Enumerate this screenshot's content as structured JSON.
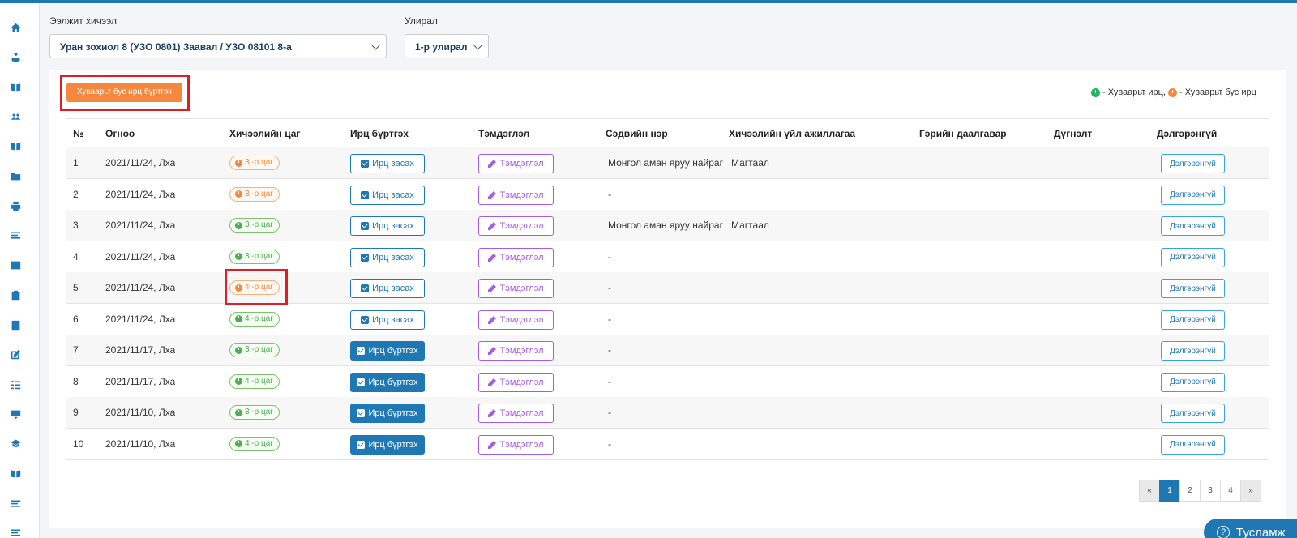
{
  "filters": {
    "course_label": "Ээлжит хичээл",
    "course_value": "Уран зохиол 8 (УЗО 0801) Заавал / УЗО 08101 8-а",
    "term_label": "Улирал",
    "term_value": "1-р улирал"
  },
  "actions": {
    "irregular_attendance": "Хуваарьт бус ирц бүртгэх"
  },
  "legend": {
    "scheduled": "- Хуваарьт ирц,",
    "unscheduled": "- Хуваарьт бус ирц",
    "colors": {
      "scheduled": "#28b463",
      "unscheduled": "#f5883e"
    }
  },
  "table": {
    "headers": [
      "№",
      "Огноо",
      "Хичээлийн цаг",
      "Ирц бүртгэх",
      "Тэмдэглэл",
      "Сэдвийн нэр",
      "Хичээлийн үйл ажиллагаа",
      "Гэрийн даалгавар",
      "Дүгнэлт",
      "Дэлгэрэнгүй"
    ],
    "rows": [
      {
        "no": "1",
        "date": "2021/11/24, Лха",
        "hour": "3 -р цаг",
        "hour_type": "orange",
        "att": "Ирц засах",
        "att_type": "edit",
        "note": "Тэмдэглэл",
        "topic": "Монгол аман яруу найраг",
        "activity": "Магтаал",
        "detail": "Дэлгэрэнгүй"
      },
      {
        "no": "2",
        "date": "2021/11/24, Лха",
        "hour": "3 -р цаг",
        "hour_type": "orange",
        "att": "Ирц засах",
        "att_type": "edit",
        "note": "Тэмдэглэл",
        "topic": "-",
        "activity": "",
        "detail": "Дэлгэрэнгүй"
      },
      {
        "no": "3",
        "date": "2021/11/24, Лха",
        "hour": "3 -р цаг",
        "hour_type": "green",
        "att": "Ирц засах",
        "att_type": "edit",
        "note": "Тэмдэглэл",
        "topic": "Монгол аман яруу найраг",
        "activity": "Магтаал",
        "detail": "Дэлгэрэнгүй"
      },
      {
        "no": "4",
        "date": "2021/11/24, Лха",
        "hour": "3 -р цаг",
        "hour_type": "green",
        "att": "Ирц засах",
        "att_type": "edit",
        "note": "Тэмдэглэл",
        "topic": "-",
        "activity": "",
        "detail": "Дэлгэрэнгүй"
      },
      {
        "no": "5",
        "date": "2021/11/24, Лха",
        "hour": "4 -р цаг",
        "hour_type": "orange",
        "att": "Ирц засах",
        "att_type": "edit",
        "note": "Тэмдэглэл",
        "topic": "-",
        "activity": "",
        "detail": "Дэлгэрэнгүй"
      },
      {
        "no": "6",
        "date": "2021/11/24, Лха",
        "hour": "4 -р цаг",
        "hour_type": "green",
        "att": "Ирц засах",
        "att_type": "edit",
        "note": "Тэмдэглэл",
        "topic": "-",
        "activity": "",
        "detail": "Дэлгэрэнгүй"
      },
      {
        "no": "7",
        "date": "2021/11/17, Лха",
        "hour": "3 -р цаг",
        "hour_type": "green",
        "att": "Ирц бүртгэх",
        "att_type": "register",
        "note": "Тэмдэглэл",
        "topic": "-",
        "activity": "",
        "detail": "Дэлгэрэнгүй"
      },
      {
        "no": "8",
        "date": "2021/11/17, Лха",
        "hour": "4 -р цаг",
        "hour_type": "green",
        "att": "Ирц бүртгэх",
        "att_type": "register",
        "note": "Тэмдэглэл",
        "topic": "-",
        "activity": "",
        "detail": "Дэлгэрэнгүй"
      },
      {
        "no": "9",
        "date": "2021/11/10, Лха",
        "hour": "3 -р цаг",
        "hour_type": "green",
        "att": "Ирц бүртгэх",
        "att_type": "register",
        "note": "Тэмдэглэл",
        "topic": "-",
        "activity": "",
        "detail": "Дэлгэрэнгүй"
      },
      {
        "no": "10",
        "date": "2021/11/10, Лха",
        "hour": "4 -р цаг",
        "hour_type": "green",
        "att": "Ирц бүртгэх",
        "att_type": "register",
        "note": "Тэмдэглэл",
        "topic": "-",
        "activity": "",
        "detail": "Дэлгэрэнгүй"
      }
    ]
  },
  "pagination": {
    "prev": "«",
    "pages": [
      "1",
      "2",
      "3",
      "4"
    ],
    "active": "1",
    "next": "»"
  },
  "help": {
    "label": "Тусламж",
    "icon": "?"
  },
  "sidebar_icons": [
    "home-icon",
    "user-book-icon",
    "book-icon",
    "users-icon",
    "book-open-icon",
    "folder-icon",
    "printer-icon",
    "menu-lines-icon",
    "table-icon",
    "clipboard-icon",
    "contact-card-icon",
    "edit-icon",
    "checklist-icon",
    "presentation-icon",
    "graduation-cap-icon",
    "book-open-icon",
    "menu-lines-icon",
    "menu-lines-icon"
  ]
}
